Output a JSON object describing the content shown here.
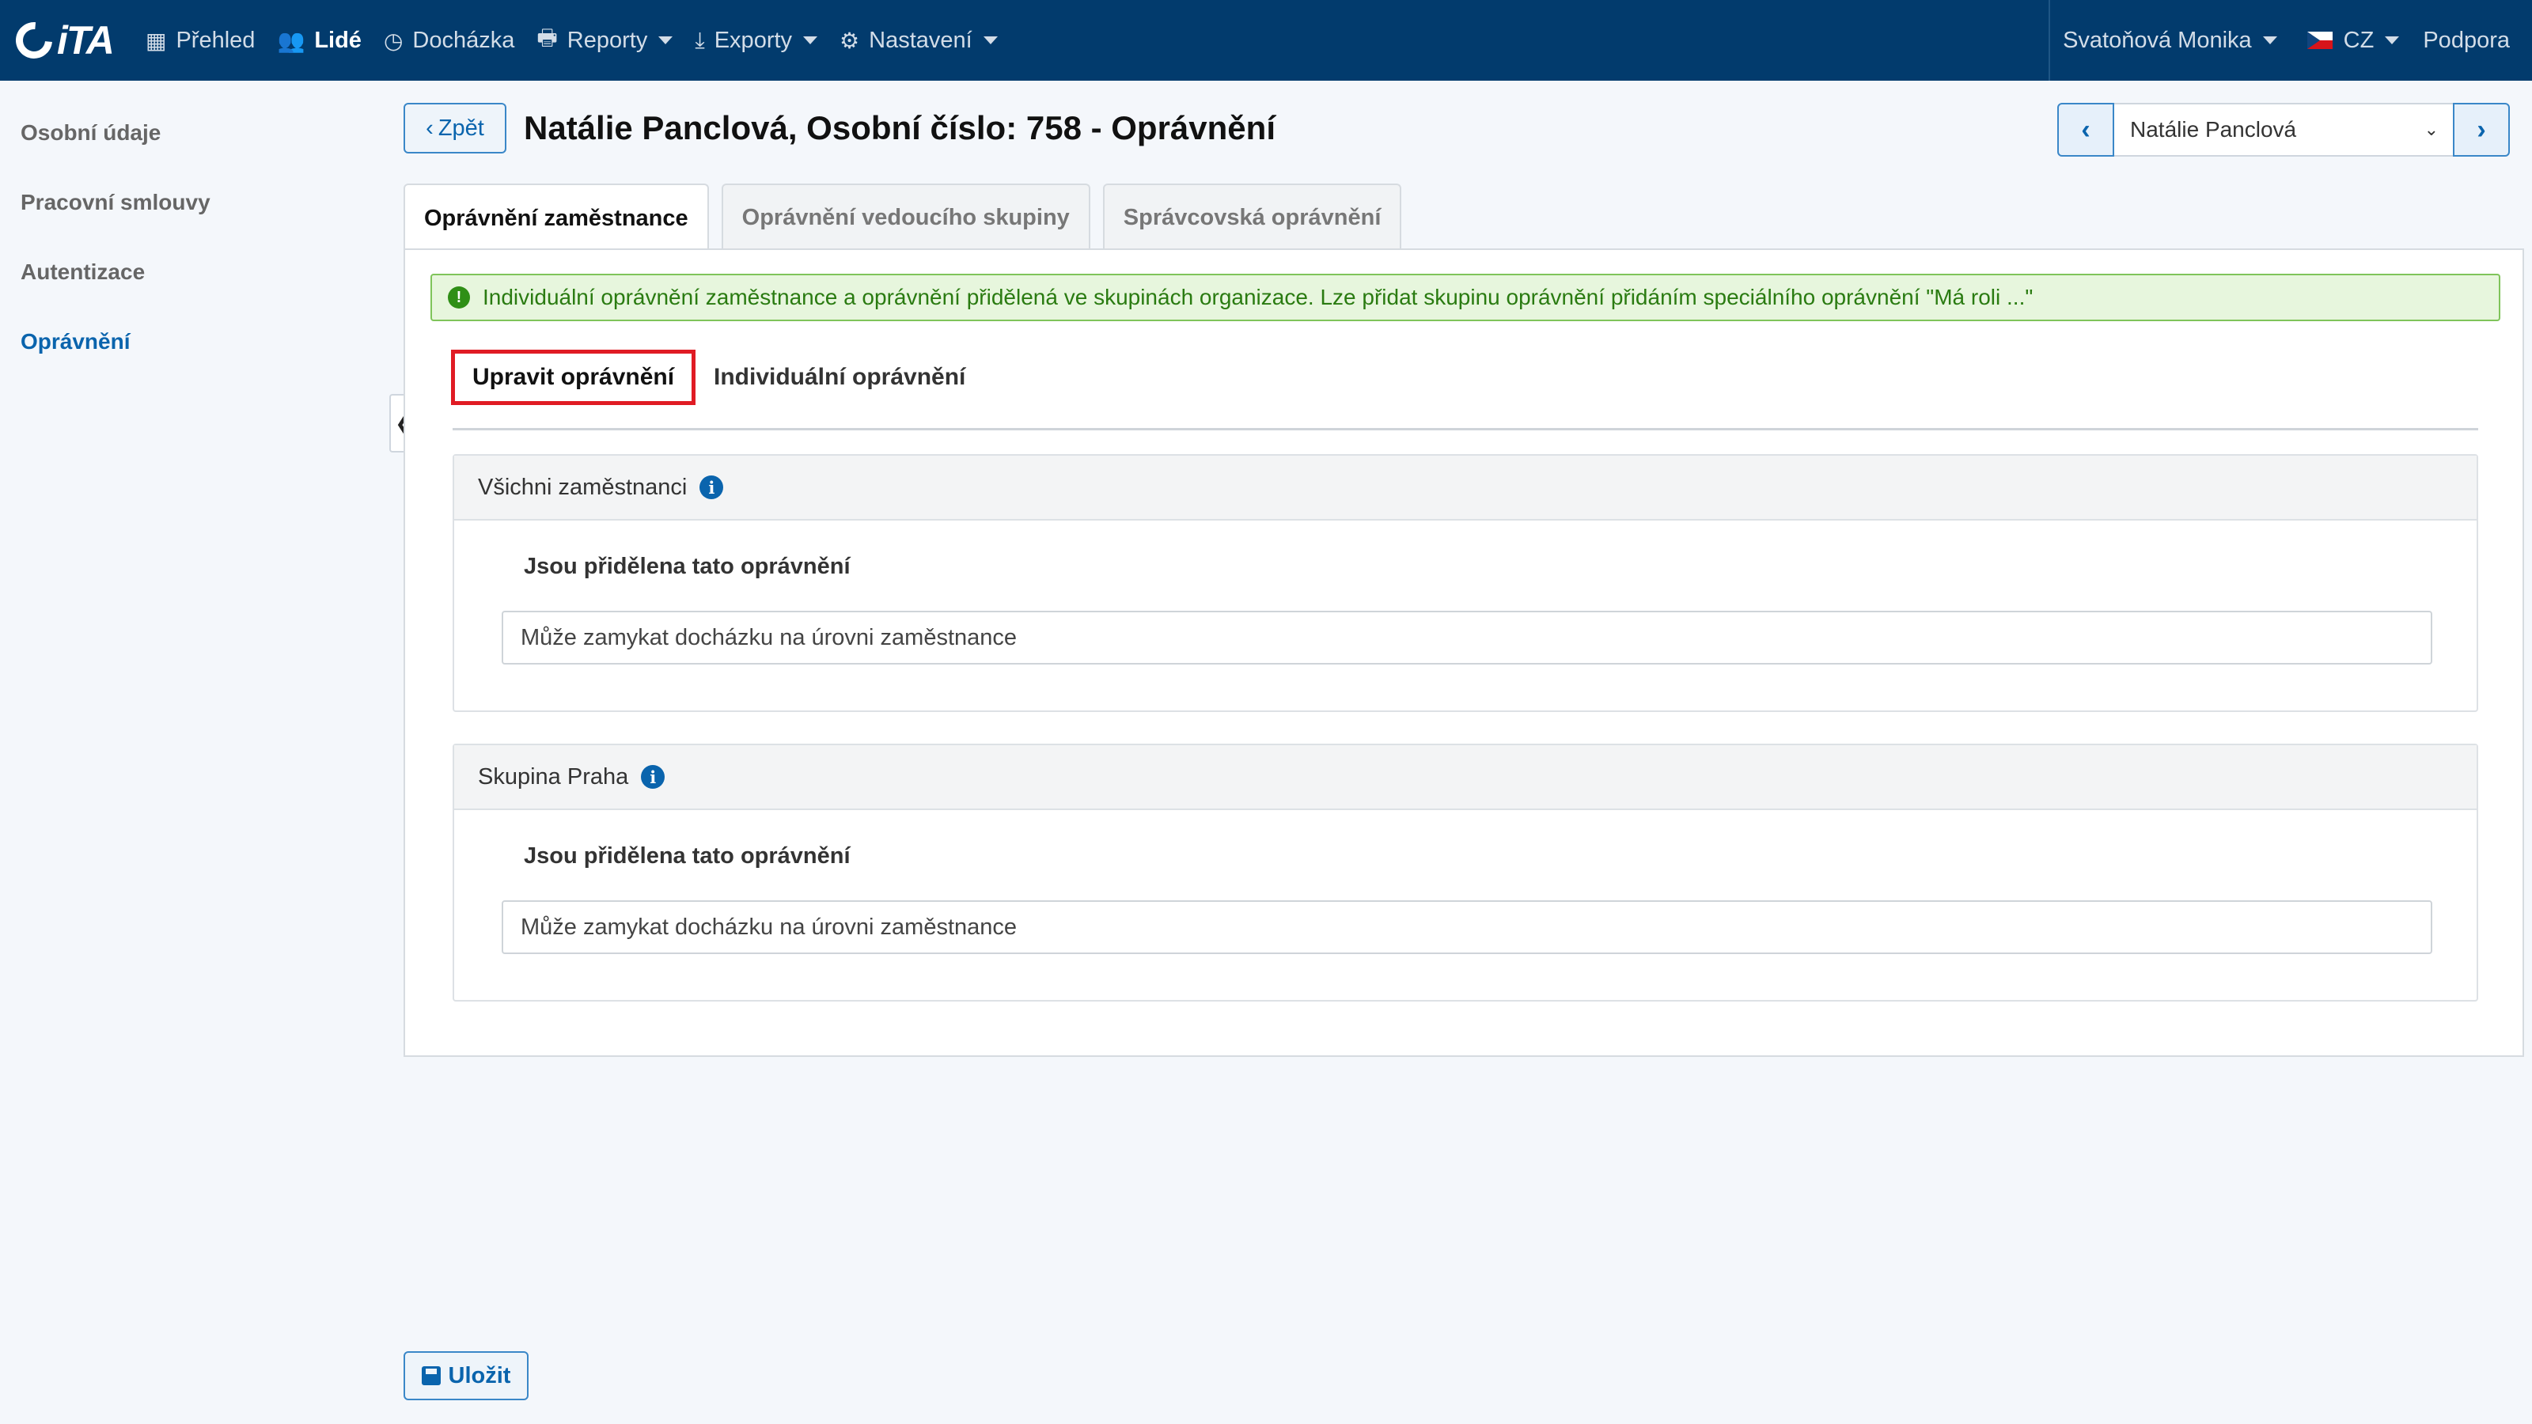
{
  "nav": {
    "logo": "iTA",
    "items": [
      {
        "label": "Přehled",
        "icon": "grid-icon"
      },
      {
        "label": "Lidé",
        "icon": "users-icon"
      },
      {
        "label": "Docházka",
        "icon": "clock-icon"
      },
      {
        "label": "Reporty",
        "icon": "printer-icon"
      },
      {
        "label": "Exporty",
        "icon": "export-icon"
      },
      {
        "label": "Nastavení",
        "icon": "gear-icon"
      }
    ],
    "user": "Svatoňová Monika",
    "language": "CZ",
    "support": "Podpora"
  },
  "sidebar": {
    "items": [
      {
        "label": "Osobní údaje"
      },
      {
        "label": "Pracovní smlouvy"
      },
      {
        "label": "Autentizace"
      },
      {
        "label": "Oprávnění"
      }
    ]
  },
  "header": {
    "back_label": "Zpět",
    "title": "Natálie Panclová, Osobní číslo: 758 - Oprávnění",
    "person_select": "Natálie Panclová"
  },
  "tabs": [
    {
      "label": "Oprávnění zaměstnance"
    },
    {
      "label": "Oprávnění vedoucího skupiny"
    },
    {
      "label": "Správcovská oprávnění"
    }
  ],
  "alert": "Individuální oprávnění zaměstnance a oprávnění přidělená ve skupinách organizace. Lze přidat skupinu oprávnění přidáním speciálního oprávnění \"Má roli ...\"",
  "subtabs": [
    {
      "label": "Upravit oprávnění"
    },
    {
      "label": "Individuální oprávnění"
    }
  ],
  "cards": [
    {
      "title": "Všichni zaměstnanci",
      "label": "Jsou přidělena tato oprávnění",
      "value": "Může zamykat docházku na úrovni zaměstnance"
    },
    {
      "title": "Skupina Praha",
      "label": "Jsou přidělena tato oprávnění",
      "value": "Může zamykat docházku na úrovni zaměstnance"
    }
  ],
  "save_label": "Uložit",
  "colors": {
    "navbar": "#023b6d",
    "accent": "#0a64ad",
    "alert_bg": "#e7f6dd",
    "alert_text": "#2a7b11",
    "highlight": "#e01b24"
  }
}
